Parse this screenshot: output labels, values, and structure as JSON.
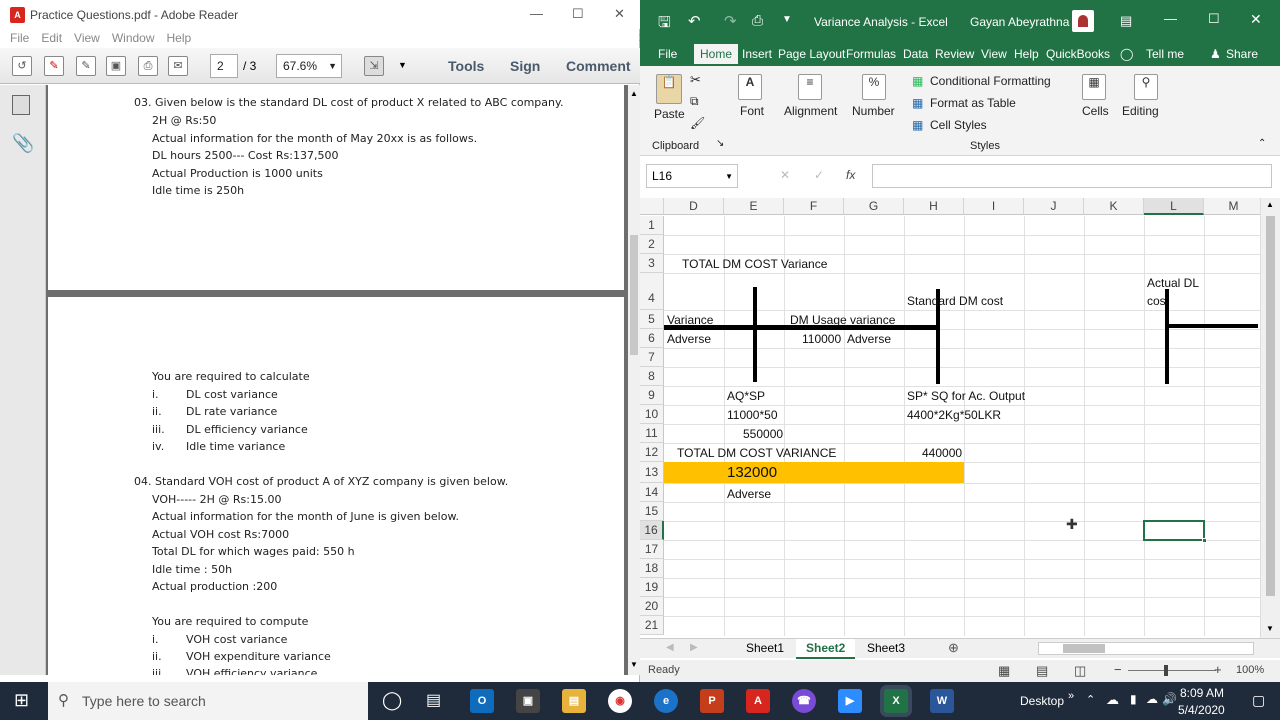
{
  "adobe": {
    "title": "Practice Questions.pdf - Adobe Reader",
    "menu": [
      "File",
      "Edit",
      "View",
      "Window",
      "Help"
    ],
    "page_current": "2",
    "page_total": "/ 3",
    "zoom": "67.6%",
    "tools": "Tools",
    "sign": "Sign",
    "comment": "Comment",
    "page1_lines": [
      "03. Given below is the standard DL cost of product X related to ABC company.",
      "2H @ Rs:50",
      "Actual information for the month of May 20xx is as follows.",
      "DL hours 2500--- Cost Rs:137,500",
      "Actual Production is 1000 units",
      "Idle time is 250h"
    ],
    "page2_lines": [
      "You are required to calculate",
      "i.",
      "DL cost variance",
      "ii.",
      "DL rate variance",
      "iii.",
      "DL efficiency variance",
      "iv.",
      "Idle time variance",
      "04. Standard VOH cost of product A of XYZ company is given below.",
      "VOH----- 2H @ Rs:15.00",
      "Actual information for the month of June is given below.",
      "Actual VOH cost Rs:7000",
      "Total DL for which wages paid: 550 h",
      "Idle time : 50h",
      "Actual production :200",
      "You are required to compute",
      "i.",
      "VOH cost variance",
      "ii.",
      "VOH expenditure variance",
      "iii.",
      "VOH efficiency variance"
    ]
  },
  "excel": {
    "title": "Variance Analysis  -  Excel",
    "user": "Gayan Abeyrathna",
    "tabs": [
      "File",
      "Home",
      "Insert",
      "Page Layout",
      "Formulas",
      "Data",
      "Review",
      "View",
      "Help",
      "QuickBooks",
      "Tell me",
      "Share"
    ],
    "ribbon": {
      "paste": "Paste",
      "clipboard": "Clipboard",
      "font": "Font",
      "alignment": "Alignment",
      "number": "Number",
      "cond_format": "Conditional Formatting",
      "format_table": "Format as Table",
      "cell_styles": "Cell Styles",
      "styles": "Styles",
      "cells": "Cells",
      "editing": "Editing"
    },
    "name_box": "L16",
    "fx": "fx",
    "columns": [
      "D",
      "E",
      "F",
      "G",
      "H",
      "I",
      "J",
      "K",
      "L",
      "M"
    ],
    "rows": [
      "1",
      "2",
      "3",
      "4",
      "5",
      "6",
      "7",
      "8",
      "9",
      "10",
      "11",
      "12",
      "13",
      "14",
      "15",
      "16",
      "17",
      "18",
      "19",
      "20",
      "21"
    ],
    "cells": {
      "r3": "TOTAL DM COST Variance",
      "r4_std": "Standard DM cost",
      "r4_act1": "Actual DL",
      "r4_act2": "cos",
      "r5_var": "Variance",
      "r5_dm": "DM Usage variance",
      "r6_adv": "Adverse",
      "r6_val": "110000",
      "r6_adv2": "Adverse",
      "r9_aq": "AQ*SP",
      "r9_sp": "SP* SQ for Ac. Output",
      "r10_a": "11000*50",
      "r10_b": "4400*2Kg*50LKR",
      "r11": "550000",
      "r12_lbl": "TOTAL DM COST VARIANCE",
      "r12_val": "440000",
      "r13": "132000",
      "r14": "Adverse"
    },
    "sheets": [
      "Sheet1",
      "Sheet2",
      "Sheet3"
    ],
    "status": "Ready",
    "zoom": "100%"
  },
  "taskbar": {
    "search": "Type here to search",
    "desktop": "Desktop",
    "time": "8:09 AM",
    "date": "5/4/2020"
  },
  "colors": {
    "excel_green": "#217346",
    "highlight": "#ffc000"
  }
}
